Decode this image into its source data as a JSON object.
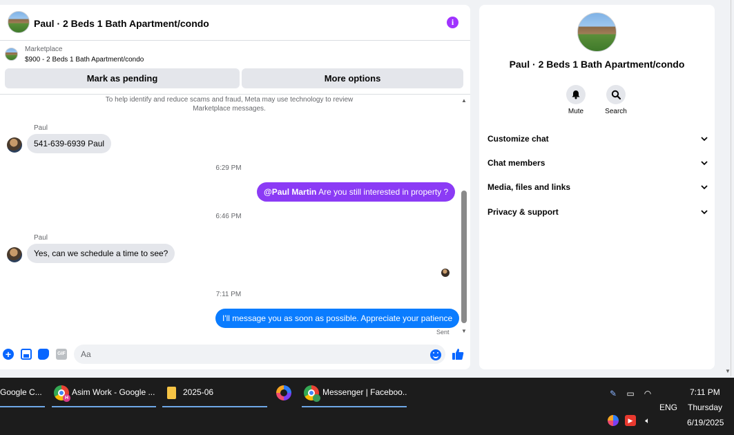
{
  "chat": {
    "header_title": "Paul · 2 Beds 1 Bath Apartment/condo",
    "marketplace_label": "Marketplace",
    "listing_title": "$900 - 2 Beds 1 Bath Apartment/condo",
    "mark_pending_label": "Mark as pending",
    "more_options_label": "More options",
    "notice": "To help identify and reduce scams and fraud, Meta may use technology to review Marketplace messages.",
    "messages": [
      {
        "sender": "Paul",
        "text": "541-639-6939 Paul",
        "direction": "in"
      },
      {
        "timestamp": "6:29 PM"
      },
      {
        "mention": "@Paul Martin",
        "text": " Are you still interested in property ?",
        "direction": "out"
      },
      {
        "timestamp": "6:46 PM"
      },
      {
        "sender": "Paul",
        "text": "Yes, can we schedule a time to see?",
        "direction": "in"
      },
      {
        "timestamp": "7:11 PM"
      },
      {
        "text": "I'll message you as soon as possible. Appreciate your patience",
        "direction": "out",
        "status": "Sent"
      }
    ],
    "composer_placeholder": "Aa",
    "icons": [
      "plus-icon",
      "photo-icon",
      "sticker-icon",
      "gif-icon",
      "emoji-icon",
      "thumbs-up-icon"
    ],
    "gif_label": "GIF"
  },
  "info": {
    "title": "Paul · 2 Beds 1 Bath Apartment/condo",
    "mute_label": "Mute",
    "search_label": "Search",
    "sections": [
      "Customize chat",
      "Chat members",
      "Media, files and links",
      "Privacy & support"
    ]
  },
  "taskbar": {
    "items": [
      {
        "label": "Google C..."
      },
      {
        "label": "Asim Work - Google ...",
        "badge": "H"
      },
      {
        "label": "2025-06"
      },
      {
        "label": "Messenger | Faceboo..."
      }
    ],
    "language": "ENG",
    "time": "7:11 PM",
    "day": "Thursday",
    "date": "6/19/2025"
  },
  "colors": {
    "accent_blue": "#0a7cff",
    "accent_purple": "#8b3bf5",
    "taskbar_bg": "#1c1c1c"
  }
}
